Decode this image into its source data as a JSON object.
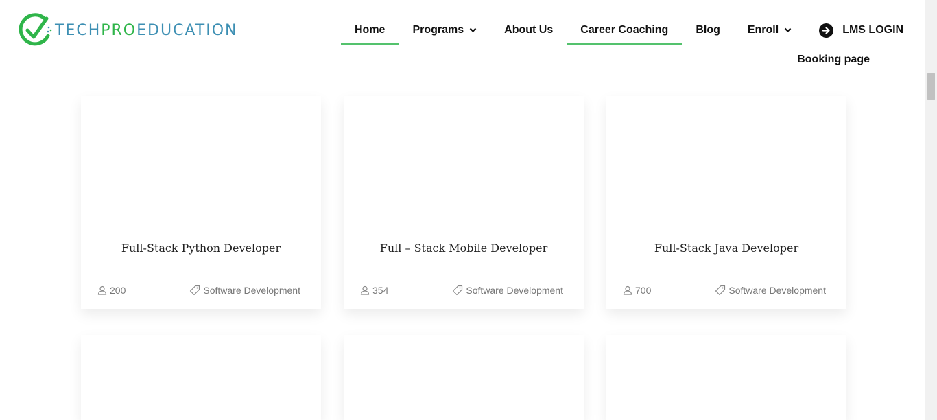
{
  "logo": {
    "part1": "TECH",
    "part2": "PRO",
    "part3": "EDUCATION",
    "colors": {
      "blue": "#3d8fb3",
      "green": "#2fb54a"
    }
  },
  "nav": {
    "items": [
      {
        "label": "Home",
        "active": true
      },
      {
        "label": "Programs",
        "dropdown": true
      },
      {
        "label": "About Us"
      },
      {
        "label": "Career Coaching",
        "active": true
      },
      {
        "label": "Blog"
      },
      {
        "label": "Enroll",
        "dropdown": true
      }
    ],
    "lms_label": "LMS LOGIN",
    "booking_label": "Booking page",
    "accent": "#54c26d"
  },
  "courses": [
    {
      "title": "Full-Stack Python Developer",
      "students": "200",
      "category": "Software Development"
    },
    {
      "title": "Full – Stack Mobile Developer",
      "students": "354",
      "category": "Software Development"
    },
    {
      "title": "Full-Stack Java Developer",
      "students": "700",
      "category": "Software Development"
    }
  ]
}
